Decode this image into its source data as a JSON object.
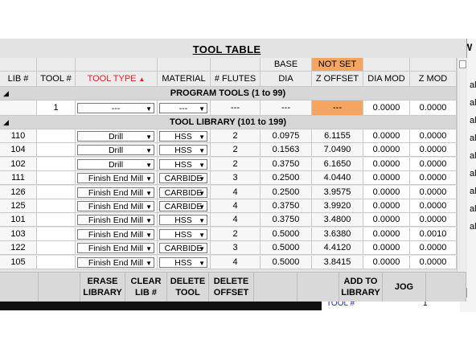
{
  "title": "TOOL TABLE",
  "meta_row": {
    "base": "BASE",
    "not_set": "NOT SET"
  },
  "columns": [
    "LIB #",
    "TOOL #",
    "TOOL TYPE",
    "MATERIAL",
    "# FLUTES",
    "DIA",
    "Z OFFSET",
    "DIA MOD",
    "Z MOD"
  ],
  "sort_icon": "triangle-up-red",
  "program_tools": {
    "label": "PROGRAM TOOLS (1 to 99)",
    "row": {
      "tool_no": "1",
      "tool_type": "---",
      "material": "---",
      "flutes": "---",
      "dia": "---",
      "z_offset": "---",
      "dia_mod": "0.0000",
      "z_mod": "0.0000"
    }
  },
  "tool_library": {
    "label": "TOOL LIBRARY (101 to 199)",
    "rows": [
      {
        "lib": "110",
        "type": "Drill",
        "material": "HSS",
        "flutes": "2",
        "dia": "0.0975",
        "z_offset": "6.1155",
        "dia_mod": "0.0000",
        "z_mod": "0.0000"
      },
      {
        "lib": "104",
        "type": "Drill",
        "material": "HSS",
        "flutes": "2",
        "dia": "0.1563",
        "z_offset": "7.0490",
        "dia_mod": "0.0000",
        "z_mod": "0.0000"
      },
      {
        "lib": "102",
        "type": "Drill",
        "material": "HSS",
        "flutes": "2",
        "dia": "0.3750",
        "z_offset": "6.1650",
        "dia_mod": "0.0000",
        "z_mod": "0.0000"
      },
      {
        "lib": "111",
        "type": "Finish End Mill",
        "material": "CARBIDE",
        "flutes": "3",
        "dia": "0.2500",
        "z_offset": "4.0440",
        "dia_mod": "0.0000",
        "z_mod": "0.0000"
      },
      {
        "lib": "126",
        "type": "Finish End Mill",
        "material": "CARBIDE",
        "flutes": "4",
        "dia": "0.2500",
        "z_offset": "3.9575",
        "dia_mod": "0.0000",
        "z_mod": "0.0000"
      },
      {
        "lib": "125",
        "type": "Finish End Mill",
        "material": "CARBIDE",
        "flutes": "4",
        "dia": "0.3750",
        "z_offset": "3.9920",
        "dia_mod": "0.0000",
        "z_mod": "0.0000"
      },
      {
        "lib": "101",
        "type": "Finish End Mill",
        "material": "HSS",
        "flutes": "4",
        "dia": "0.3750",
        "z_offset": "3.4800",
        "dia_mod": "0.0000",
        "z_mod": "0.0000"
      },
      {
        "lib": "103",
        "type": "Finish End Mill",
        "material": "HSS",
        "flutes": "2",
        "dia": "0.5000",
        "z_offset": "3.6380",
        "dia_mod": "0.0000",
        "z_mod": "0.0010"
      },
      {
        "lib": "122",
        "type": "Finish End Mill",
        "material": "CARBIDE",
        "flutes": "3",
        "dia": "0.5000",
        "z_offset": "4.4120",
        "dia_mod": "0.0000",
        "z_mod": "0.0000"
      },
      {
        "lib": "105",
        "type": "Finish End Mill",
        "material": "HSS",
        "flutes": "4",
        "dia": "0.5000",
        "z_offset": "3.8415",
        "dia_mod": "0.0000",
        "z_mod": "0.0000"
      }
    ]
  },
  "buttons": {
    "erase_library": [
      "ERASE",
      "LIBRARY"
    ],
    "clear_lib": [
      "CLEAR",
      "LIB #"
    ],
    "delete_tool": [
      "DELETE",
      "TOOL"
    ],
    "delete_offset": [
      "DELETE",
      "OFFSET"
    ],
    "add_to_library": [
      "ADD TO",
      "LIBRARY"
    ],
    "jog": "JOG"
  },
  "background": {
    "right_labels": [
      "al",
      "al",
      "al",
      "al",
      "al",
      "al",
      "al",
      "al",
      "al"
    ],
    "corner_text": "W",
    "bottom_label": "TOOL #",
    "bottom_value": "1"
  },
  "colors": {
    "accent_orange": "#f5a55f",
    "sort_red": "#e1261c",
    "link_blue": "#1c2fb5"
  }
}
